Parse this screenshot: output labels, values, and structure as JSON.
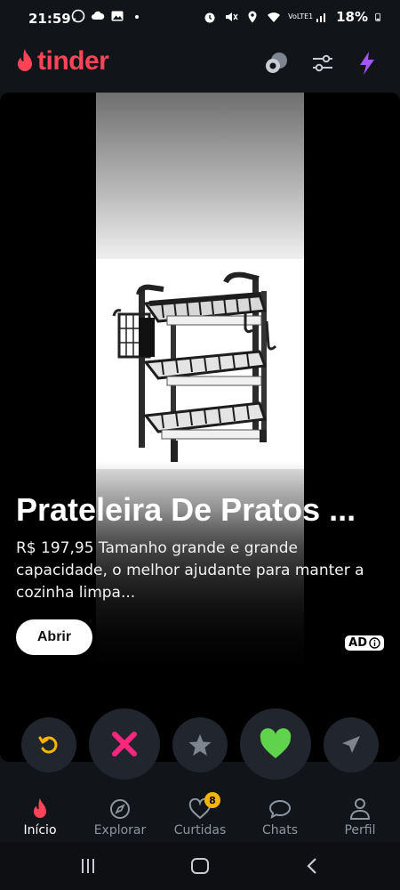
{
  "status_bar": {
    "time": "21:59",
    "battery": "18%",
    "network": "VoLTE1",
    "left_icons": [
      "whatsapp-icon",
      "cloud-icon",
      "gallery-icon",
      "dot-icon"
    ],
    "right_icons": [
      "alarm-icon",
      "mute-icon",
      "location-icon",
      "wifi-icon",
      "signal-icon",
      "battery-icon"
    ]
  },
  "header": {
    "logo_text": "tinder",
    "buttons": [
      "chat-bubbles-icon",
      "filters-icon",
      "boost-icon"
    ]
  },
  "card": {
    "title": "Prateleira De Pratos ...",
    "description": "R$ 197,95 Tamanho grande e grande capacidade, o melhor ajudante para manter a cozinha limpa...",
    "cta_label": "Abrir",
    "ad_label": "AD",
    "image": "dish-rack-product-photo"
  },
  "actions": [
    {
      "name": "rewind-button",
      "icon": "rewind-icon",
      "color": "#f5b400"
    },
    {
      "name": "nope-button",
      "icon": "close-icon",
      "color": "#fd267d"
    },
    {
      "name": "super-like-button",
      "icon": "star-icon",
      "color": "#7d8590"
    },
    {
      "name": "like-button",
      "icon": "heart-icon",
      "color": "#5fd34b"
    },
    {
      "name": "boost-send-button",
      "icon": "send-icon",
      "color": "#7d8590"
    }
  ],
  "nav": {
    "items": [
      {
        "label": "Início",
        "icon": "flame-icon",
        "active": true
      },
      {
        "label": "Explorar",
        "icon": "compass-icon",
        "active": false
      },
      {
        "label": "Curtidas",
        "icon": "heart-outline-icon",
        "active": false,
        "badge": "8"
      },
      {
        "label": "Chats",
        "icon": "chat-icon",
        "active": false
      },
      {
        "label": "Perfil",
        "icon": "person-icon",
        "active": false
      }
    ]
  },
  "colors": {
    "brand": "#ff4458",
    "background": "#111418",
    "badge": "#f5b400",
    "boost": "#a855f7"
  }
}
